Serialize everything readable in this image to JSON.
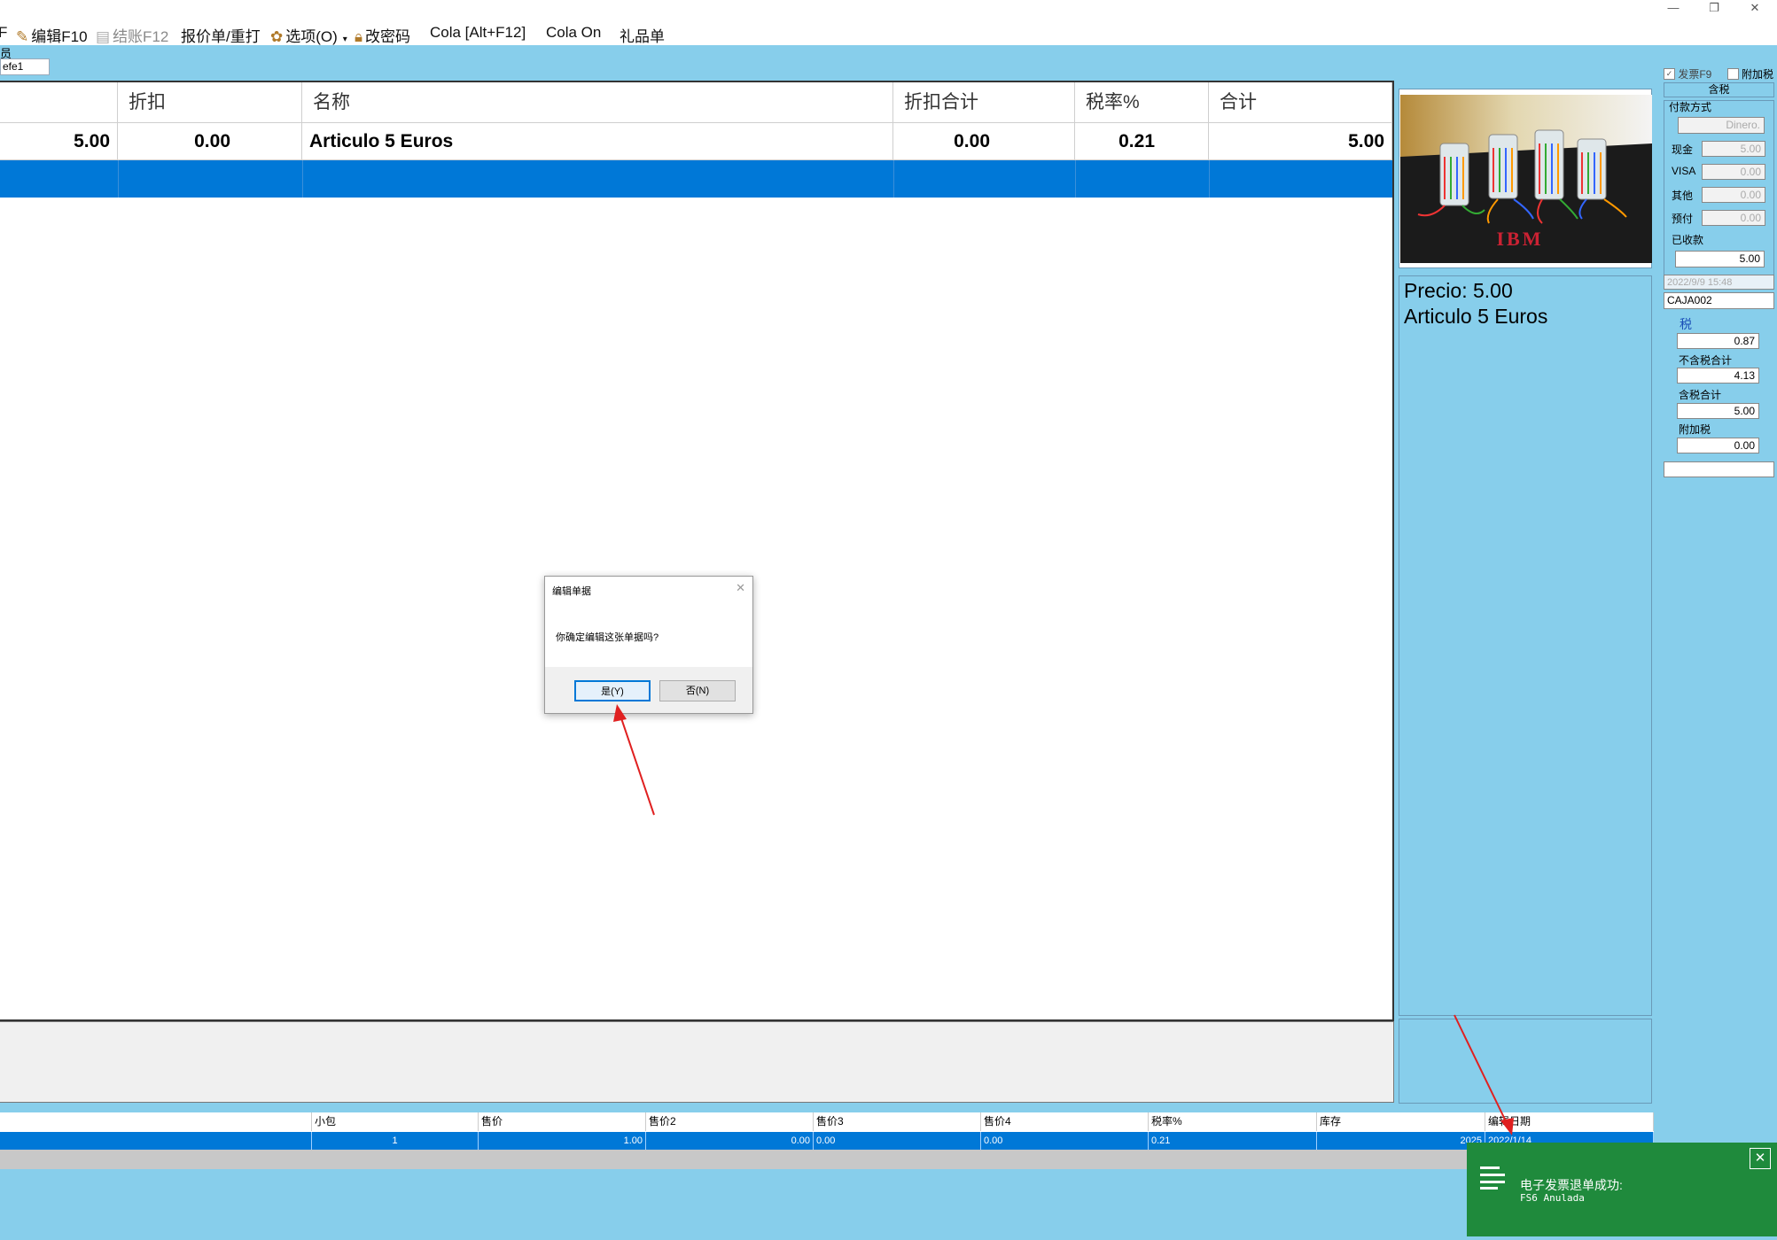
{
  "window": {
    "minimize": "—",
    "restore": "❐",
    "close": "✕"
  },
  "menu": {
    "partial_left": "F",
    "edit": "编辑F10",
    "checkout": "结账F12",
    "quote": "报价单/重打",
    "options": "选项(O)",
    "password": "改密码",
    "cola_alt": "Cola [Alt+F12]",
    "cola_on": "Cola On",
    "gift": "礼品单"
  },
  "user": {
    "label": "员",
    "value": "efe1"
  },
  "grid": {
    "headers": [
      "折扣",
      "名称",
      "折扣合计",
      "税率%",
      "合计"
    ],
    "row": {
      "price": "5.00",
      "discount": "0.00",
      "name": "Articulo 5 Euros",
      "discount_total": "0.00",
      "tax": "0.21",
      "total": "5.00"
    }
  },
  "product_panel": {
    "price_line": "Precio: 5.00",
    "name_line": "Articulo 5 Euros",
    "image_brand": "IBM"
  },
  "right_sidebar": {
    "invoice_cb": "发票F9",
    "surcharge_cb": "附加税",
    "tax_incl": "含税",
    "payment_label": "付款方式",
    "payment_method": "Dinero.",
    "cash_label": "现金",
    "cash": "5.00",
    "visa_label": "VISA",
    "visa": "0.00",
    "other_label": "其他",
    "other": "0.00",
    "prepaid_label": "预付",
    "prepaid": "0.00",
    "received_label": "已收款",
    "received": "5.00",
    "datetime": "2022/9/9 15:48",
    "register": "CAJA002",
    "tax_label": "税",
    "tax": "0.87",
    "net_label": "不含税合计",
    "net": "4.13",
    "gross_label": "含税合计",
    "gross": "5.00",
    "surcharge_label": "附加税",
    "surcharge": "0.00"
  },
  "bottom_table": {
    "headers": [
      "小包",
      "售价",
      "售价2",
      "售价3",
      "售价4",
      "税率%",
      "库存",
      "编辑日期"
    ],
    "row": [
      "1",
      "1.00",
      "0.00",
      "0.00",
      "0.00",
      "0.21",
      "2025",
      "2022/1/14"
    ]
  },
  "dialog": {
    "title": "编辑单据",
    "message": "你确定编辑这张单据吗?",
    "yes": "是(Y)",
    "no": "否(N)",
    "close": "✕"
  },
  "toast": {
    "line1": "电子发票退单成功:",
    "line2": "FS6 Anulada",
    "close": "✕"
  }
}
